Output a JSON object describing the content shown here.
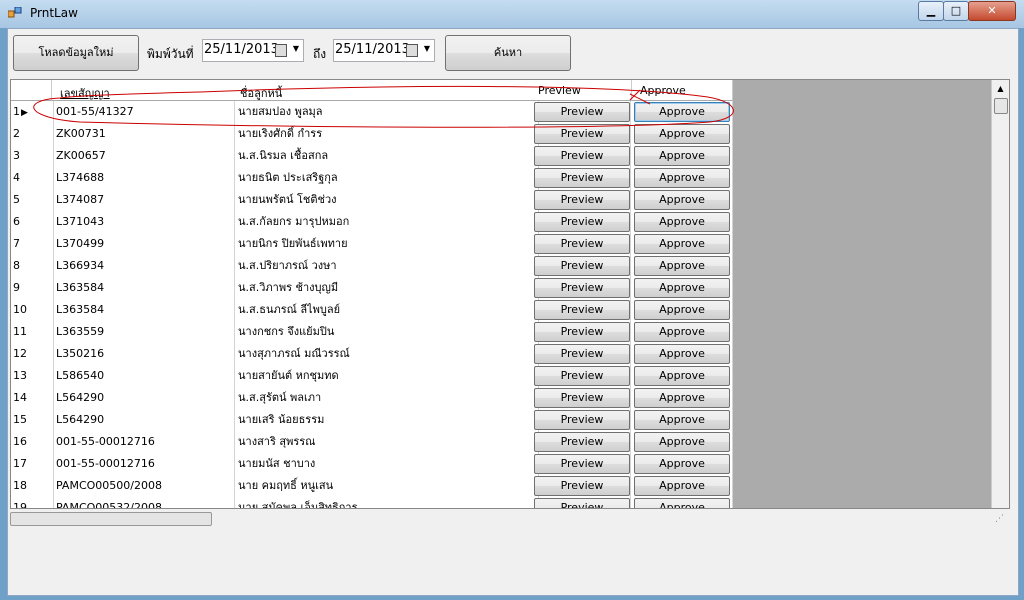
{
  "window": {
    "title": "PrntLaw"
  },
  "toolbar": {
    "reload_label": "โหลดข้อมูลใหม่",
    "from_label": "พิมพ์วันที่",
    "from_date": "25/11/2013",
    "to_label": "ถึง",
    "to_date": "25/11/2013",
    "search_label": "ค้นหา"
  },
  "grid": {
    "columns": [
      "เลขสัญญา",
      "ชื่อลูกหนี้",
      "Preview",
      "Approve"
    ],
    "preview_label": "Preview",
    "approve_label": "Approve",
    "rows": [
      {
        "no": "1",
        "contract": "001-55/41327",
        "name": "นายสมปอง พูลมุล"
      },
      {
        "no": "2",
        "contract": "ZK00731",
        "name": "นายเริงศักดิ์ กำรร"
      },
      {
        "no": "3",
        "contract": "ZK00657",
        "name": "น.ส.นิรมล เชื้อสกล"
      },
      {
        "no": "4",
        "contract": "L374688",
        "name": "นายธนิต ประเสริฐกุล"
      },
      {
        "no": "5",
        "contract": "L374087",
        "name": "นายนพรัตน์ โชติช่วง"
      },
      {
        "no": "6",
        "contract": "L371043",
        "name": "น.ส.กัลยกร มารุปหมอก"
      },
      {
        "no": "7",
        "contract": "L370499",
        "name": "นายนิกร ปิยพันธ์เพทาย"
      },
      {
        "no": "8",
        "contract": "L366934",
        "name": "น.ส.ปริยาภรณ์ วงษา"
      },
      {
        "no": "9",
        "contract": "L363584",
        "name": "น.ส.วิภาพร ช้างบุญมี"
      },
      {
        "no": "10",
        "contract": "L363584",
        "name": "น.ส.ธนภรณ์ ลีไพบูลย์"
      },
      {
        "no": "11",
        "contract": "L363559",
        "name": "นางกชกร จึงแย้มปิน"
      },
      {
        "no": "12",
        "contract": "L350216",
        "name": "นางสุภาภรณ์ มณีวรรณ์"
      },
      {
        "no": "13",
        "contract": "L586540",
        "name": "นายสายันต์ หกชุมทด"
      },
      {
        "no": "14",
        "contract": "L564290",
        "name": "น.ส.สุรัตน์ พลเภา"
      },
      {
        "no": "15",
        "contract": "L564290",
        "name": "นายเสริ น้อยธรรม"
      },
      {
        "no": "16",
        "contract": "001-55-00012716",
        "name": "นางสาริ สุพรรณ"
      },
      {
        "no": "17",
        "contract": "001-55-00012716",
        "name": "นายมนัส ชาบาง"
      },
      {
        "no": "18",
        "contract": "PAMCO00500/2008",
        "name": "นาย คมฤทธิ์ หนูเสน"
      },
      {
        "no": "19",
        "contract": "PAMCO00532/2008",
        "name": "นาย สมัคพล เอ็มสิทธิการ"
      }
    ]
  },
  "colors": {
    "window_frame": "#6fa0c8",
    "annotation": "#cc0000"
  },
  "icons": [
    "app-icon",
    "minimize-icon",
    "maximize-icon",
    "close-icon",
    "calendar-icon",
    "dropdown-arrow-icon",
    "row-pointer-icon",
    "scroll-up-icon",
    "resize-grip-icon"
  ]
}
